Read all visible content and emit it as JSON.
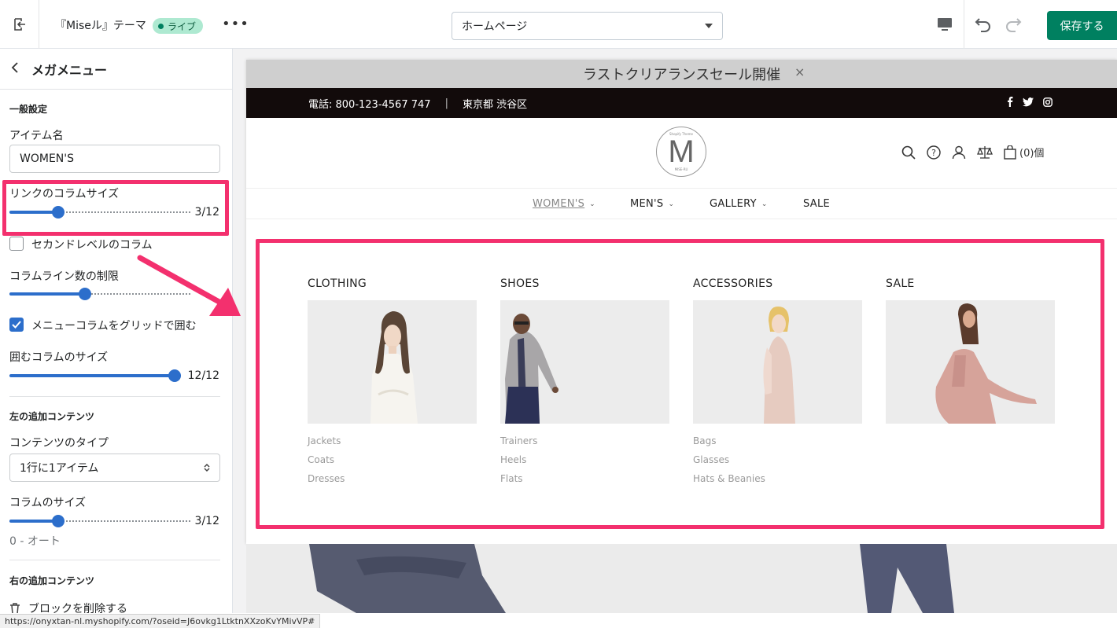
{
  "topbar": {
    "theme_name": "『Miseル』テーマ",
    "live_badge": "ライブ",
    "more": "•••",
    "page_select": "ホームページ",
    "save_label": "保存する"
  },
  "sidebar": {
    "title": "メガメニュー",
    "general_section": "一般設定",
    "item_name_label": "アイテム名",
    "item_name_value": "WOMEN'S",
    "link_col_size_label": "リンクのコラムサイズ",
    "link_col_size_value": "3/12",
    "link_col_size_fraction": 0.25,
    "second_level_label": "セカンドレベルのコラム",
    "second_level_checked": false,
    "col_line_limit_label": "コラムライン数の制限",
    "col_line_limit_fraction": 0.41,
    "grid_wrap_label": "メニューコラムをグリッドで囲む",
    "grid_wrap_checked": true,
    "wrap_col_size_label": "囲むコラムのサイズ",
    "wrap_col_size_value": "12/12",
    "wrap_col_size_fraction": 1.0,
    "left_extra_section": "左の追加コンテンツ",
    "content_type_label": "コンテンツのタイプ",
    "content_type_value": "1行に1アイテム",
    "col_size_label": "コラムのサイズ",
    "col_size_value": "3/12",
    "col_size_fraction": 0.25,
    "col_size_hint": "0 - オート",
    "right_extra_section": "右の追加コンテンツ",
    "delete_block": "ブロックを削除する"
  },
  "preview": {
    "announcement": "ラストクリアランスセール開催",
    "announcement_close": "×",
    "phone": "電話: 800-123-4567 747",
    "separator": "|",
    "location": "東京都 渋谷区",
    "logo_small_top": "Shopify Theme",
    "logo_letter": "M",
    "logo_small_bottom": "MISE-RU",
    "cart_count": "(0)個",
    "nav": [
      "WOMEN'S",
      "MEN'S",
      "GALLERY",
      "SALE"
    ],
    "mega": [
      {
        "title": "CLOTHING",
        "links": [
          "Jackets",
          "Coats",
          "Dresses"
        ]
      },
      {
        "title": "SHOES",
        "links": [
          "Trainers",
          "Heels",
          "Flats"
        ]
      },
      {
        "title": "ACCESSORIES",
        "links": [
          "Bags",
          "Glasses",
          "Hats & Beanies"
        ]
      },
      {
        "title": "SALE",
        "links": []
      }
    ]
  },
  "status_url": "https://onyxtan-nl.myshopify.com/?oseid=J6ovkg1LtktnXXzoKvYMivVP#",
  "colors": {
    "highlight": "#f3306e",
    "save_green": "#008060",
    "slider_blue": "#2c6ecb",
    "live_badge": "#aee9d1",
    "info_bar": "#120b0b"
  }
}
